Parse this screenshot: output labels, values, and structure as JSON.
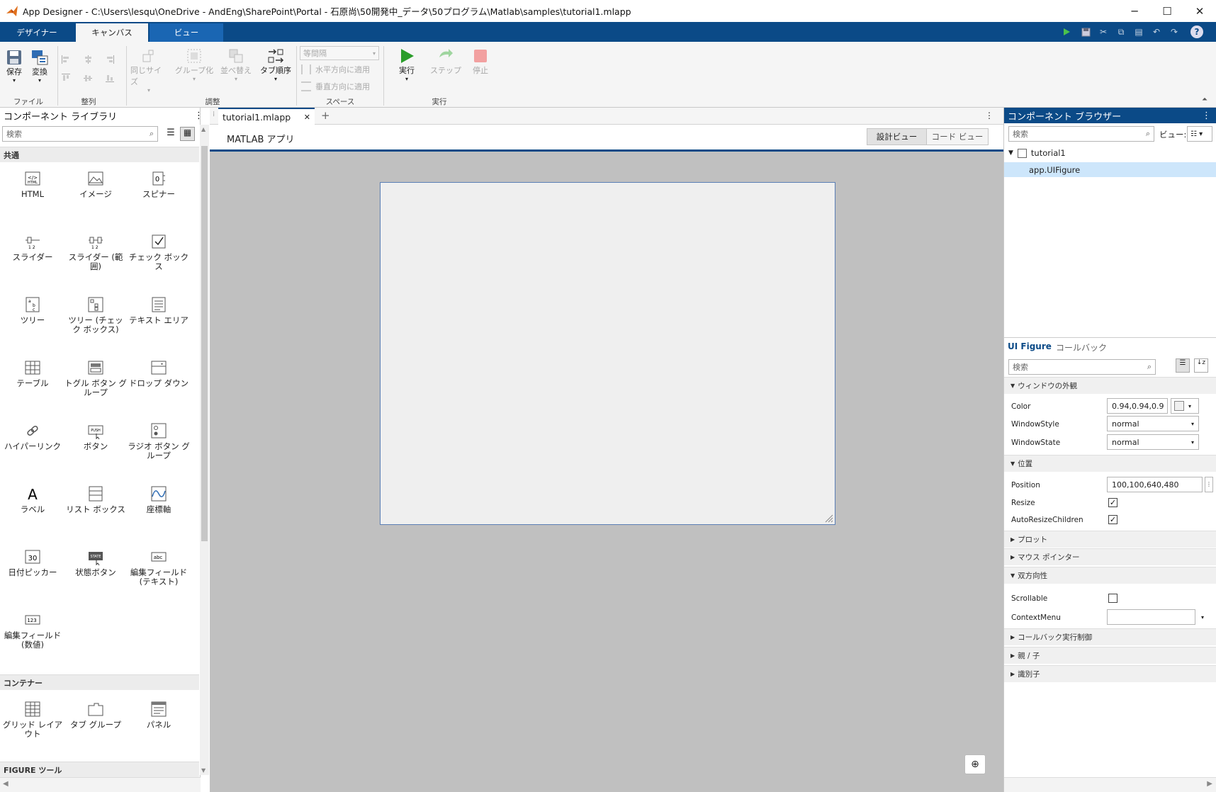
{
  "window": {
    "title": "App Designer - C:\\Users\\lesqu\\OneDrive - AndEng\\SharePoint\\Portal - 石原尚\\50開発中_データ\\50プログラム\\Matlab\\samples\\tutorial1.mlapp",
    "minimize": "─",
    "maximize": "☐",
    "close": "✕"
  },
  "ribbon": {
    "tabs": [
      "デザイナー",
      "キャンバス",
      "ビュー"
    ],
    "file": {
      "save": "保存",
      "convert": "変換",
      "group": "ファイル"
    },
    "align": {
      "group": "整列"
    },
    "arrange": {
      "same_size": "同じサイズ",
      "group_btn": "グループ化",
      "reorder": "並べ替え",
      "tab_order": "タブ順序",
      "group": "調整"
    },
    "space": {
      "select": "等間隔",
      "horizontal": "水平方向に適用",
      "vertical": "垂直方向に適用",
      "group": "スペース"
    },
    "run": {
      "run": "実行",
      "step": "ステップ",
      "stop": "停止",
      "group": "実行"
    }
  },
  "library": {
    "title": "コンポーネント ライブラリ",
    "search_placeholder": "検索",
    "sections": {
      "common": "共通",
      "containers": "コンテナー",
      "figure_tools": "FIGURE ツール"
    },
    "common": [
      {
        "label": "HTML",
        "icon": "html-icon"
      },
      {
        "label": "イメージ",
        "icon": "image-icon"
      },
      {
        "label": "スピナー",
        "icon": "spinner-icon"
      },
      {
        "label": "スライダー",
        "icon": "slider-icon"
      },
      {
        "label": "スライダー (範囲)",
        "icon": "range-slider-icon"
      },
      {
        "label": "チェック ボックス",
        "icon": "checkbox-icon"
      },
      {
        "label": "ツリー",
        "icon": "tree-icon"
      },
      {
        "label": "ツリー (チェック ボックス)",
        "icon": "checkbox-tree-icon"
      },
      {
        "label": "テキスト エリア",
        "icon": "text-area-icon"
      },
      {
        "label": "テーブル",
        "icon": "table-icon"
      },
      {
        "label": "トグル ボタン グループ",
        "icon": "toggle-group-icon"
      },
      {
        "label": "ドロップ ダウン",
        "icon": "dropdown-icon"
      },
      {
        "label": "ハイパーリンク",
        "icon": "hyperlink-icon"
      },
      {
        "label": "ボタン",
        "icon": "push-button-icon"
      },
      {
        "label": "ラジオ ボタン グループ",
        "icon": "radio-group-icon"
      },
      {
        "label": "ラベル",
        "icon": "label-icon"
      },
      {
        "label": "リスト ボックス",
        "icon": "listbox-icon"
      },
      {
        "label": "座標軸",
        "icon": "axes-icon"
      },
      {
        "label": "日付ピッカー",
        "icon": "date-picker-icon"
      },
      {
        "label": "状態ボタン",
        "icon": "state-button-icon"
      },
      {
        "label": "編集フィールド (テキスト)",
        "icon": "edit-text-icon"
      },
      {
        "label": "編集フィールド (数値)",
        "icon": "edit-numeric-icon"
      }
    ],
    "icon_text": {
      "html": "</>",
      "spinner": "0",
      "state": "STATE",
      "push": "PUSH",
      "date": "30",
      "abc": "abc",
      "num": "123",
      "label": "A"
    },
    "containers": [
      {
        "label": "グリッド レイアウト",
        "icon": "grid-layout-icon"
      },
      {
        "label": "タブ グループ",
        "icon": "tab-group-icon"
      },
      {
        "label": "パネル",
        "icon": "panel-icon"
      }
    ]
  },
  "document": {
    "tab": "tutorial1.mlapp",
    "add": "+",
    "app_label": "MATLAB アプリ",
    "design_view": "設計ビュー",
    "code_view": "コード ビュー"
  },
  "browser": {
    "title": "コンポーネント ブラウザー",
    "search_placeholder": "検索",
    "view_label": "ビュー:",
    "root": "tutorial1",
    "child": "app.UIFigure"
  },
  "inspector": {
    "tab_active": "UI Figure",
    "tab_other": "コールバック",
    "search_placeholder": "検索",
    "groups": {
      "window": "ウィンドウの外観",
      "position": "位置",
      "plot": "プロット",
      "pointer": "マウス ポインター",
      "interactivity": "双方向性",
      "callback": "コールバック実行制御",
      "parent": "親 / 子",
      "identifiers": "識別子"
    },
    "props": {
      "color": {
        "name": "Color",
        "value": "0.94,0.94,0.9"
      },
      "window_style": {
        "name": "WindowStyle",
        "value": "normal"
      },
      "window_state": {
        "name": "WindowState",
        "value": "normal"
      },
      "position": {
        "name": "Position",
        "value": "100,100,640,480"
      },
      "resize": {
        "name": "Resize",
        "value": true
      },
      "auto_resize": {
        "name": "AutoResizeChildren",
        "value": true
      },
      "scrollable": {
        "name": "Scrollable",
        "value": false
      },
      "context_menu": {
        "name": "ContextMenu",
        "value": ""
      }
    }
  },
  "colors": {
    "ribbon": "#0b4a87",
    "run": "#2a9d2a",
    "stop": "#e05252",
    "selection": "#cde6fb"
  }
}
